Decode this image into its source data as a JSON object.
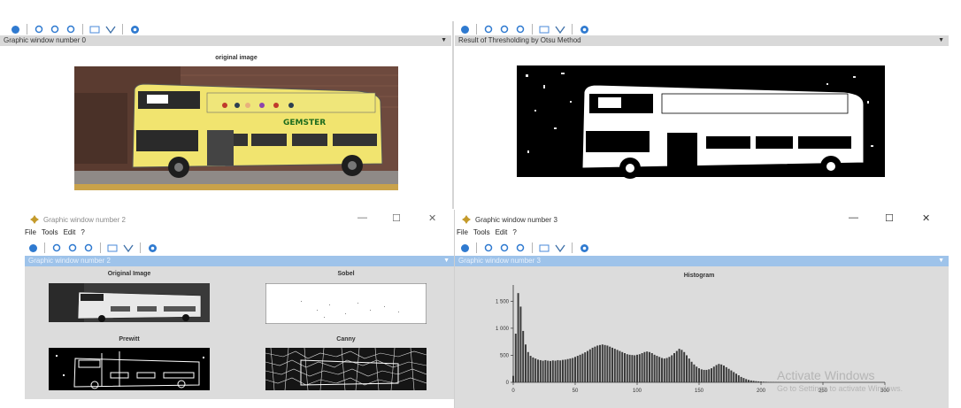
{
  "top_left": {
    "header": "Graphic window number 0",
    "title": "original image",
    "sign_text": "GEMSTER"
  },
  "top_right": {
    "header": "Result of Thresholding by Otsu Method"
  },
  "bottom_left": {
    "window_title": "Graphic window number 2",
    "menu": [
      "File",
      "Tools",
      "Edit",
      "?"
    ],
    "header": "Graphic window number 2",
    "titles": [
      "Original Image",
      "Sobel",
      "Prewitt",
      "Canny"
    ]
  },
  "bottom_right": {
    "window_title": "Graphic window number 3",
    "menu": [
      "File",
      "Tools",
      "Edit",
      "?"
    ],
    "header": "Graphic window number 3",
    "histogram_title": "Histogram"
  },
  "window_controls": {
    "minimize": "—",
    "maximize": "☐",
    "close": "✕"
  },
  "watermark": {
    "line1": "Activate Windows",
    "line2": "Go to Settings to activate Windows."
  },
  "icons": [
    "rotate-icon",
    "zoom-in-icon",
    "zoom-out-icon",
    "zoom-fit-icon",
    "rectangle-icon",
    "datatip-icon",
    "help-icon"
  ],
  "chart_data": {
    "type": "bar",
    "title": "Histogram",
    "xlabel": "",
    "ylabel": "",
    "x_ticks": [
      0,
      50,
      100,
      150,
      200,
      250,
      300
    ],
    "y_ticks": [
      0,
      500,
      1000,
      1500
    ],
    "x_tick_labels": [
      "0",
      "50",
      "100",
      "150",
      "200",
      "250",
      "300"
    ],
    "y_tick_labels": [
      "0",
      "500",
      "1 000",
      "1 500"
    ],
    "xlim": [
      0,
      300
    ],
    "ylim": [
      0,
      1800
    ],
    "x": [
      0,
      2,
      4,
      6,
      8,
      10,
      12,
      14,
      16,
      18,
      20,
      22,
      24,
      26,
      28,
      30,
      32,
      34,
      36,
      38,
      40,
      42,
      44,
      46,
      48,
      50,
      52,
      54,
      56,
      58,
      60,
      62,
      64,
      66,
      68,
      70,
      72,
      74,
      76,
      78,
      80,
      82,
      84,
      86,
      88,
      90,
      92,
      94,
      96,
      98,
      100,
      102,
      104,
      106,
      108,
      110,
      112,
      114,
      116,
      118,
      120,
      122,
      124,
      126,
      128,
      130,
      132,
      134,
      136,
      138,
      140,
      142,
      144,
      146,
      148,
      150,
      152,
      154,
      156,
      158,
      160,
      162,
      164,
      166,
      168,
      170,
      172,
      174,
      176,
      178,
      180,
      182,
      184,
      186,
      188,
      190,
      192,
      194,
      196,
      198,
      200,
      202,
      204,
      206,
      208,
      210,
      212,
      214,
      216,
      218,
      220,
      222,
      224,
      226,
      228,
      230,
      232,
      234,
      236,
      238,
      240,
      242,
      244,
      246,
      248,
      250,
      252,
      254
    ],
    "values": [
      120,
      900,
      1650,
      1400,
      950,
      700,
      560,
      490,
      460,
      440,
      420,
      410,
      400,
      410,
      400,
      395,
      405,
      400,
      410,
      405,
      415,
      420,
      430,
      440,
      450,
      470,
      490,
      510,
      530,
      555,
      580,
      610,
      640,
      660,
      680,
      690,
      700,
      690,
      680,
      660,
      640,
      620,
      600,
      580,
      560,
      540,
      520,
      510,
      505,
      500,
      510,
      520,
      540,
      560,
      570,
      560,
      540,
      510,
      490,
      470,
      450,
      440,
      450,
      470,
      500,
      540,
      580,
      620,
      600,
      560,
      500,
      440,
      380,
      330,
      290,
      260,
      240,
      230,
      230,
      240,
      260,
      290,
      320,
      340,
      330,
      310,
      280,
      250,
      220,
      190,
      160,
      130,
      100,
      80,
      60,
      45,
      35,
      28,
      22,
      18,
      15,
      12,
      10,
      8,
      6,
      5,
      4,
      3,
      3,
      2,
      2,
      2,
      1,
      1,
      1,
      1,
      1,
      1,
      1,
      1,
      1,
      1,
      1,
      1,
      1,
      1,
      1,
      1
    ]
  }
}
